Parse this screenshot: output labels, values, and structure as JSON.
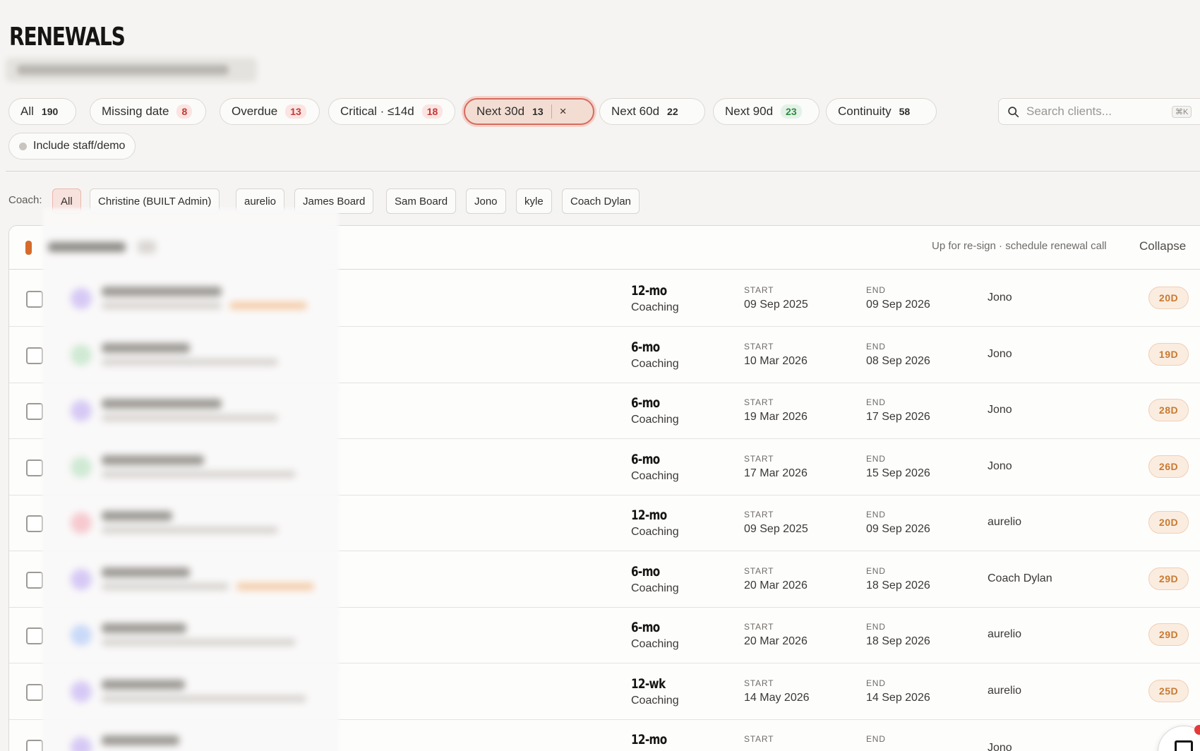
{
  "page": {
    "title": "RENEWALS"
  },
  "filters": [
    {
      "label": "All",
      "count": "190",
      "style": "plain"
    },
    {
      "label": "Missing date",
      "count": "8",
      "style": "red"
    },
    {
      "label": "Overdue",
      "count": "13",
      "style": "red"
    },
    {
      "label": "Critical · ≤14d",
      "count": "18",
      "style": "red"
    },
    {
      "label": "Next 30d",
      "count": "13",
      "style": "active"
    },
    {
      "label": "Next 60d",
      "count": "22",
      "style": "plain"
    },
    {
      "label": "Next 90d",
      "count": "23",
      "style": "green"
    },
    {
      "label": "Continuity",
      "count": "58",
      "style": "plain"
    }
  ],
  "active_filter_clear": "×",
  "search": {
    "placeholder": "Search clients...",
    "shortcut": "⌘K",
    "icon": "search-icon"
  },
  "staff_toggle": {
    "label": "Include staff/demo"
  },
  "coach_filter": {
    "label": "Coach:",
    "options": [
      "All",
      "Christine (BUILT Admin)",
      "aurelio",
      "James Board",
      "Sam Board",
      "Jono",
      "kyle",
      "Coach Dylan"
    ],
    "selected": "All"
  },
  "group": {
    "note": "Up for re-sign · schedule renewal call",
    "collapse_label": "Collapse",
    "marker_color": "#d66a2a"
  },
  "columns": {
    "start_label": "START",
    "end_label": "END"
  },
  "rows": [
    {
      "duration": "12-mo",
      "plan": "Coaching",
      "start": "09 Sep 2025",
      "end": "09 Sep 2026",
      "coach": "Jono",
      "days": "20D"
    },
    {
      "duration": "6-mo",
      "plan": "Coaching",
      "start": "10 Mar 2026",
      "end": "08 Sep 2026",
      "coach": "Jono",
      "days": "19D"
    },
    {
      "duration": "6-mo",
      "plan": "Coaching",
      "start": "19 Mar 2026",
      "end": "17 Sep 2026",
      "coach": "Jono",
      "days": "28D"
    },
    {
      "duration": "6-mo",
      "plan": "Coaching",
      "start": "17 Mar 2026",
      "end": "15 Sep 2026",
      "coach": "Jono",
      "days": "26D"
    },
    {
      "duration": "12-mo",
      "plan": "Coaching",
      "start": "09 Sep 2025",
      "end": "09 Sep 2026",
      "coach": "aurelio",
      "days": "20D"
    },
    {
      "duration": "6-mo",
      "plan": "Coaching",
      "start": "20 Mar 2026",
      "end": "18 Sep 2026",
      "coach": "Coach Dylan",
      "days": "29D"
    },
    {
      "duration": "6-mo",
      "plan": "Coaching",
      "start": "20 Mar 2026",
      "end": "18 Sep 2026",
      "coach": "aurelio",
      "days": "29D"
    },
    {
      "duration": "12-wk",
      "plan": "Coaching",
      "start": "14 May 2026",
      "end": "14 Sep 2026",
      "coach": "aurelio",
      "days": "25D"
    },
    {
      "duration": "12-mo",
      "plan": "",
      "start": "",
      "end": "",
      "coach": "Jono",
      "days": ""
    }
  ],
  "colors": {
    "accent": "#d56b5f",
    "days_badge": "#c77a32",
    "notification": "#e63a3a"
  }
}
